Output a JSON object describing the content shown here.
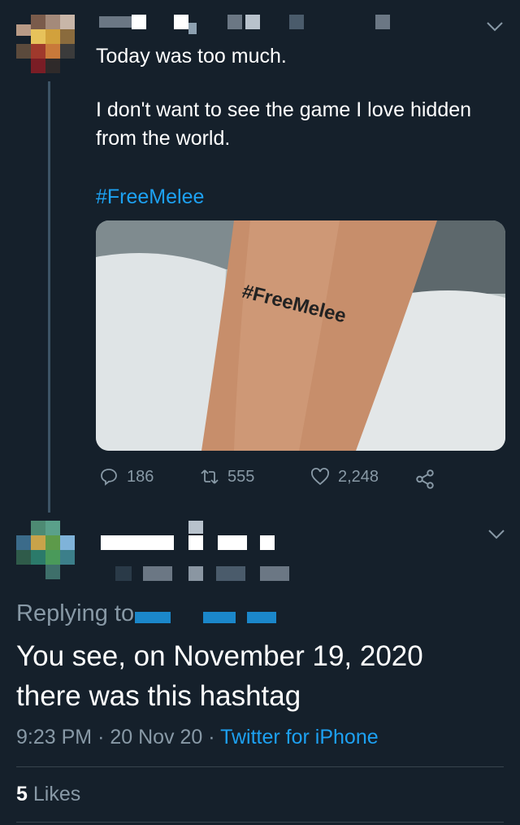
{
  "colors": {
    "background": "#15202b",
    "accent": "#1da1f2",
    "muted": "#8899a6",
    "text": "#ffffff"
  },
  "tweet": {
    "line1": "Today was too much.",
    "line2": "I don't want to see the game I love hidden",
    "line3": "from the world.",
    "hashtag": "#FreeMelee",
    "photo_caption": "#FreeMelee",
    "replies": "186",
    "retweets": "555",
    "likes": "2,248",
    "icons": [
      "reply-icon",
      "retweet-icon",
      "like-icon",
      "share-icon",
      "chevron-down-icon"
    ]
  },
  "reply": {
    "replying_to_label": "Replying to",
    "text_line1": "You see, on November 19, 2020",
    "text_line2": "there was this hashtag",
    "time": "9:23 PM",
    "date": "20 Nov 20",
    "separator": "·",
    "source": "Twitter for iPhone",
    "likes_count": "5",
    "likes_label": "Likes"
  }
}
